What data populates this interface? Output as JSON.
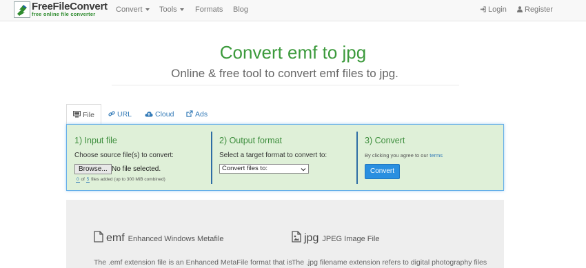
{
  "brand": {
    "name": "FreeFileConvert",
    "tagline": "free online file converter"
  },
  "nav": {
    "items": [
      {
        "label": "Convert",
        "dropdown": true
      },
      {
        "label": "Tools",
        "dropdown": true
      },
      {
        "label": "Formats",
        "dropdown": false
      },
      {
        "label": "Blog",
        "dropdown": false
      }
    ],
    "login": "Login",
    "register": "Register"
  },
  "hero": {
    "title": "Convert emf to jpg",
    "subtitle": "Online & free tool to convert emf files to jpg."
  },
  "tabs": [
    {
      "label": "File",
      "icon": "monitor-icon",
      "active": true
    },
    {
      "label": "URL",
      "icon": "link-icon",
      "active": false
    },
    {
      "label": "Cloud",
      "icon": "cloud-icon",
      "active": false
    },
    {
      "label": "Ads",
      "icon": "external-link-icon",
      "active": false
    }
  ],
  "steps": {
    "input": {
      "title": "1) Input file",
      "instruction": "Choose source file(s) to convert:",
      "browse_label": "Browse...",
      "no_file": "No file selected.",
      "count_added": "0",
      "count_max": "5",
      "count_of": "of",
      "count_suffix": "files added (up to 300 MiB combined)"
    },
    "output": {
      "title": "2) Output format",
      "instruction": "Select a target format to convert to:",
      "select_value": "Convert files to:"
    },
    "convert": {
      "title": "3) Convert",
      "agree_text": "By clicking you agree to our",
      "terms_link": "terms",
      "button_label": "Convert"
    }
  },
  "formats": {
    "source": {
      "ext": "emf",
      "full_name": "Enhanced Windows Metafile",
      "description": "The .emf extension file is an Enhanced MetaFile format that is"
    },
    "target": {
      "ext": "jpg",
      "full_name": "JPEG Image File",
      "description": "The .jpg filename extension refers to digital photography files"
    }
  },
  "colors": {
    "accent_green": "#3c9a3c",
    "link_blue": "#337ab7",
    "panel_bg": "#dff0d8",
    "button_blue": "#2a8fe0"
  }
}
